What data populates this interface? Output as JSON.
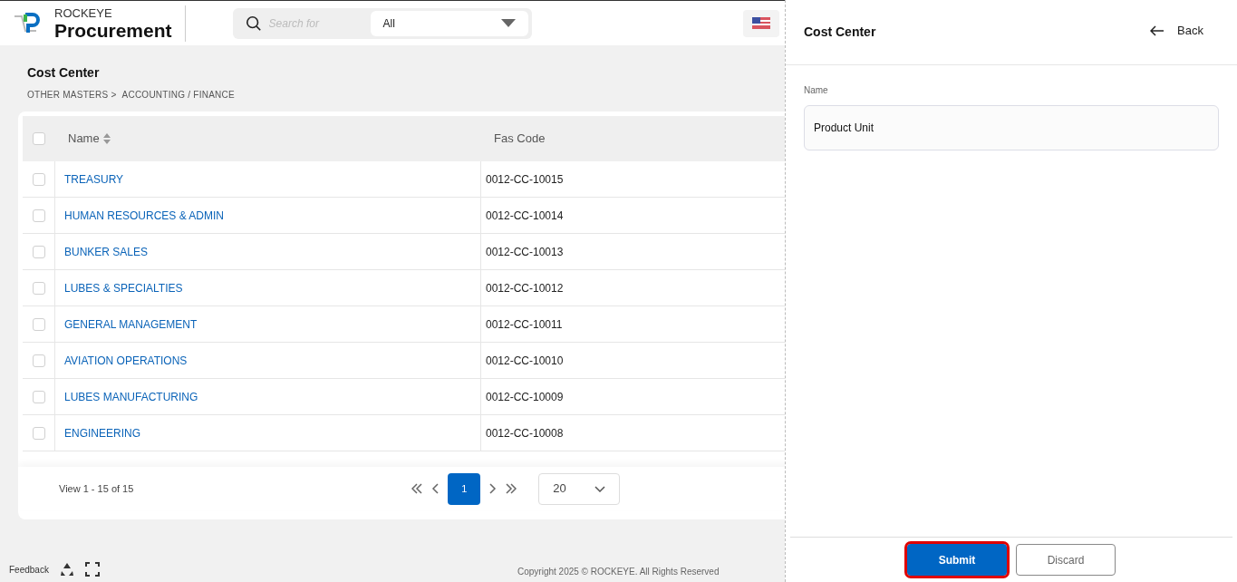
{
  "header": {
    "brand_top": "ROCKEYE",
    "brand_name": "Procurement",
    "search": {
      "placeholder": "Search for"
    },
    "scope_select": "All"
  },
  "page": {
    "title": "Cost Center",
    "breadcrumb": [
      "OTHER MASTERS >",
      "ACCOUNTING / FINANCE"
    ]
  },
  "table": {
    "select_all_checked": false,
    "columns": [
      {
        "label": "Name",
        "sortable": true
      },
      {
        "label": "Fas Code",
        "sortable": false
      }
    ],
    "rows": [
      {
        "name": "TREASURY",
        "fas_code": "0012-CC-10015",
        "checked": false
      },
      {
        "name": "HUMAN RESOURCES & ADMIN",
        "fas_code": "0012-CC-10014",
        "checked": false
      },
      {
        "name": "BUNKER SALES",
        "fas_code": "0012-CC-10013",
        "checked": false
      },
      {
        "name": "LUBES & SPECIALTIES",
        "fas_code": "0012-CC-10012",
        "checked": false
      },
      {
        "name": "GENERAL MANAGEMENT",
        "fas_code": "0012-CC-10011",
        "checked": false
      },
      {
        "name": "AVIATION OPERATIONS",
        "fas_code": "0012-CC-10010",
        "checked": false
      },
      {
        "name": "LUBES MANUFACTURING",
        "fas_code": "0012-CC-10009",
        "checked": false
      },
      {
        "name": "ENGINEERING",
        "fas_code": "0012-CC-10008",
        "checked": false
      }
    ]
  },
  "pagination": {
    "summary": "View 1 - 15 of 15",
    "pages": [
      {
        "label": "1",
        "selected": true
      }
    ],
    "page_size": "20"
  },
  "footer": {
    "feedback": "Feedback",
    "copyright": "Copyright 2025 © ROCKEYE. All Rights Reserved"
  },
  "drawer": {
    "title": "Cost Center",
    "back": "Back",
    "field": {
      "label": "Name",
      "value": "Product Unit"
    },
    "buttons": [
      {
        "label": "Submit",
        "kind": "primary",
        "highlighted": true
      },
      {
        "label": "Discard",
        "kind": "secondary",
        "highlighted": false
      }
    ]
  }
}
